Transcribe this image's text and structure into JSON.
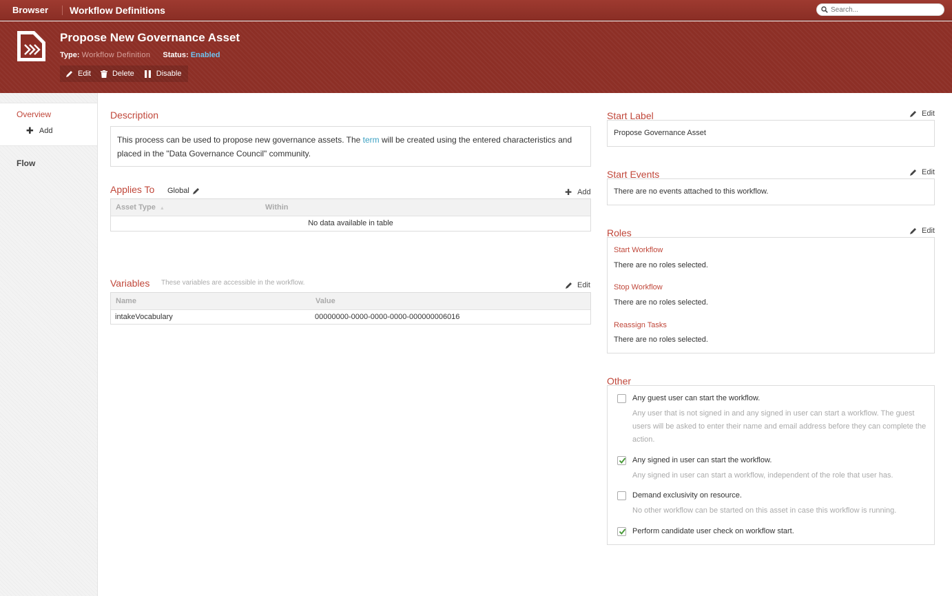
{
  "topbar": {
    "breadcrumb_root": "Browser",
    "breadcrumb_current": "Workflow Definitions",
    "search_placeholder": "Search..."
  },
  "header": {
    "title": "Propose New Governance Asset",
    "type_label": "Type:",
    "type_value": "Workflow Definition",
    "status_label": "Status:",
    "status_value": "Enabled",
    "actions": {
      "edit": "Edit",
      "delete": "Delete",
      "disable": "Disable"
    }
  },
  "sidebar": {
    "overview": "Overview",
    "add": "Add",
    "flow": "Flow"
  },
  "description": {
    "heading": "Description",
    "text_before": "This process can be used to propose new governance assets. The ",
    "link": "term",
    "text_after": " will be created using the entered characteristics and placed in the \"Data Governance Council\" community."
  },
  "applies_to": {
    "heading": "Applies To",
    "scope": "Global",
    "add": "Add",
    "columns": [
      "Asset Type",
      "Within"
    ],
    "empty": "No data available in table"
  },
  "variables": {
    "heading": "Variables",
    "note": "These variables are accessible in the workflow.",
    "edit": "Edit",
    "columns": [
      "Name",
      "Value"
    ],
    "rows": [
      {
        "name": "intakeVocabulary",
        "value": "00000000-0000-0000-0000-000000006016"
      }
    ]
  },
  "start_label": {
    "heading": "Start Label",
    "edit": "Edit",
    "value": "Propose Governance Asset"
  },
  "start_events": {
    "heading": "Start Events",
    "edit": "Edit",
    "value": "There are no events attached to this workflow."
  },
  "roles": {
    "heading": "Roles",
    "edit": "Edit",
    "items": [
      {
        "name": "Start Workflow",
        "value": "There are no roles selected."
      },
      {
        "name": "Stop Workflow",
        "value": "There are no roles selected."
      },
      {
        "name": "Reassign Tasks",
        "value": "There are no roles selected."
      }
    ]
  },
  "other": {
    "heading": "Other",
    "options": [
      {
        "label": "Any guest user can start the workflow.",
        "desc": "Any user that is not signed in and any signed in user can start a workflow. The guest users will be asked to enter their name and email address before they can complete the action.",
        "checked": false
      },
      {
        "label": "Any signed in user can start the workflow.",
        "desc": "Any signed in user can start a workflow, independent of the role that user has.",
        "checked": true
      },
      {
        "label": "Demand exclusivity on resource.",
        "desc": "No other workflow can be started on this asset in case this workflow is running.",
        "checked": false
      },
      {
        "label": "Perform candidate user check on workflow start.",
        "desc": "",
        "checked": true
      }
    ]
  },
  "colors": {
    "brand_red": "#8d2f26",
    "accent_red": "#c0473a",
    "link_blue": "#3aa0c2",
    "check_green": "#4a9a3a"
  }
}
